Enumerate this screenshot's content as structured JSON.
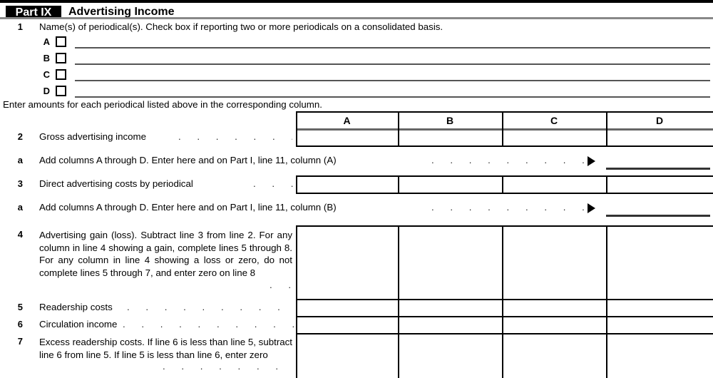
{
  "part": {
    "tag": "Part IX",
    "title": "Advertising Income"
  },
  "line1": {
    "number": "1",
    "text": "Name(s) of periodical(s). Check box if reporting two or more periodicals on a consolidated basis.",
    "entries": [
      {
        "letter": "A",
        "value": ""
      },
      {
        "letter": "B",
        "value": ""
      },
      {
        "letter": "C",
        "value": ""
      },
      {
        "letter": "D",
        "value": ""
      }
    ]
  },
  "instruction": "Enter amounts for each periodical listed above in the corresponding column.",
  "columns": [
    "A",
    "B",
    "C",
    "D"
  ],
  "rows": [
    {
      "number": "2",
      "text": "Gross advertising income",
      "leader": ". . . . . . . .",
      "values": [
        "",
        "",
        "",
        ""
      ]
    },
    {
      "number": "a",
      "text": "Add columns A through D. Enter here and on Part I, line 11, column (A)",
      "leader": ". . . . . . . . . . . .",
      "total": ""
    },
    {
      "number": "3",
      "text": "Direct advertising costs by periodical",
      "leader": ". . .",
      "values": [
        "",
        "",
        "",
        ""
      ]
    },
    {
      "number": "a",
      "text": "Add columns A through D. Enter here and on Part I, line 11, column (B)",
      "leader": ". . . . . . . . . . . .",
      "total": ""
    },
    {
      "number": "4",
      "text": "Advertising gain (loss). Subtract line 3 from line 2. For any column in line 4 showing a gain, complete lines 5 through 8. For any column in line 4 showing a loss or zero, do not complete lines 5 through 7, and enter zero on line 8",
      "leader": ". .",
      "values": [
        "",
        "",
        "",
        ""
      ]
    },
    {
      "number": "5",
      "text": "Readership costs",
      "leader": ". . . . . . . . . .",
      "values": [
        "",
        "",
        "",
        ""
      ]
    },
    {
      "number": "6",
      "text": "Circulation income",
      "leader": ". . . . . . . . . .",
      "values": [
        "",
        "",
        "",
        ""
      ]
    },
    {
      "number": "7",
      "text": "Excess readership costs. If line 6 is less than line 5, subtract line 6 from line 5. If line 5 is less than line 6, enter zero",
      "leader": ". . . . . . . . .",
      "values": [
        "",
        "",
        "",
        ""
      ]
    }
  ]
}
